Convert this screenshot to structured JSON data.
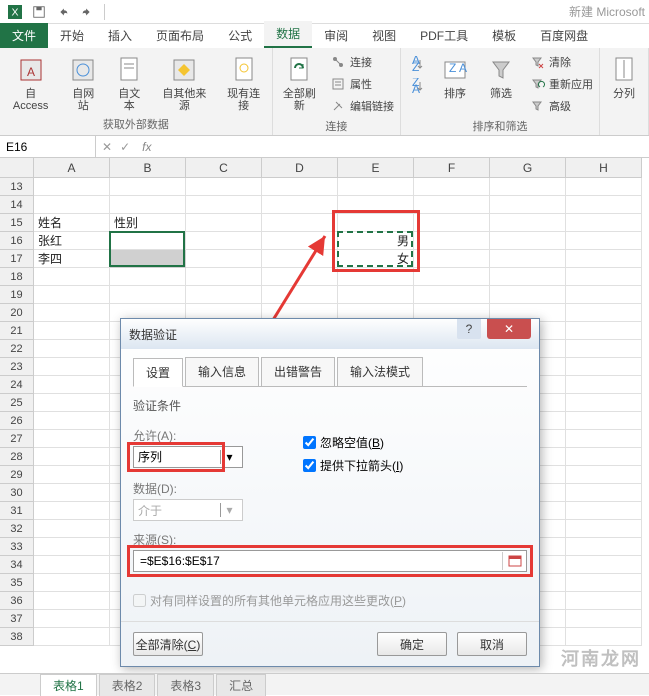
{
  "title_bar": {
    "doc_title": "新建 Microsoft"
  },
  "ribbon": {
    "file_tab": "文件",
    "tabs": [
      "开始",
      "插入",
      "页面布局",
      "公式",
      "数据",
      "审阅",
      "视图",
      "PDF工具",
      "模板",
      "百度网盘"
    ],
    "active_tab_index": 4,
    "groups": {
      "external": {
        "label": "获取外部数据",
        "access": "自 Access",
        "web": "自网站",
        "text": "自文本",
        "other": "自其他来源",
        "existing": "现有连接"
      },
      "connections": {
        "label": "连接",
        "refresh": "全部刷新",
        "conn": "连接",
        "prop": "属性",
        "edit": "编辑链接"
      },
      "sort": {
        "label": "排序和筛选",
        "sort": "排序",
        "filter": "筛选",
        "clear": "清除",
        "reapply": "重新应用",
        "advanced": "高级"
      },
      "tools": {
        "column": "分列"
      }
    }
  },
  "name_box": "E16",
  "columns": [
    "A",
    "B",
    "C",
    "D",
    "E",
    "F",
    "G",
    "H"
  ],
  "first_row": 13,
  "last_row": 38,
  "cells": {
    "A15": "姓名",
    "B15": "性别",
    "A16": "张红",
    "A17": "李四",
    "E16": "男",
    "E17": "女"
  },
  "dialog": {
    "title": "数据验证",
    "tabs": [
      "设置",
      "输入信息",
      "出错警告",
      "输入法模式"
    ],
    "active_tab_index": 0,
    "section_label": "验证条件",
    "allow_label": "允许(A):",
    "allow_value": "序列",
    "data_label": "数据(D):",
    "data_value": "介于",
    "ignore_blank": "忽略空值(B)",
    "dropdown": "提供下拉箭头(I)",
    "source_label": "来源(S):",
    "source_value": "=$E$16:$E$17",
    "apply_all": "对有同样设置的所有其他单元格应用这些更改(P)",
    "clear_all": "全部清除(C)",
    "ok": "确定",
    "cancel": "取消"
  },
  "sheet_tabs": [
    "表格1",
    "表格2",
    "表格3",
    "汇总"
  ],
  "watermark": "河南龙网"
}
